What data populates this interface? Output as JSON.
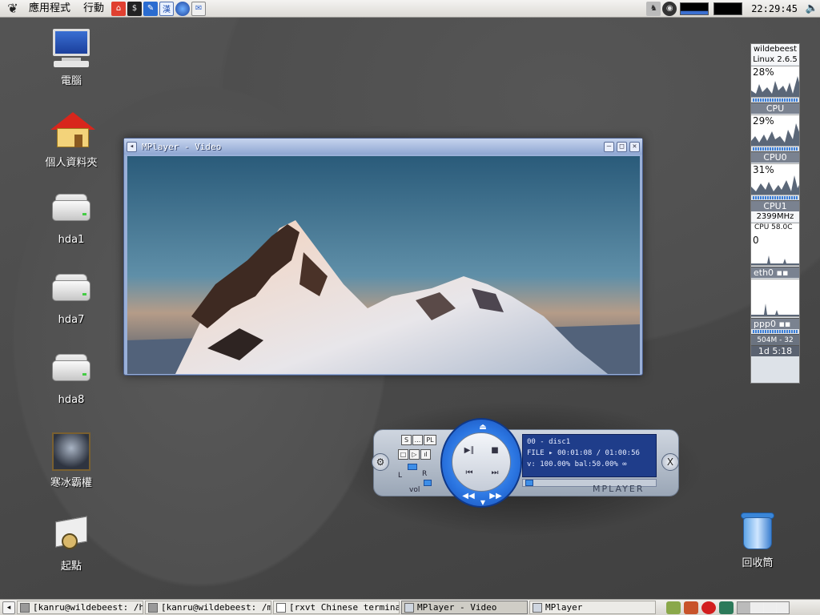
{
  "top_panel": {
    "menus": [
      "應用程式",
      "行動"
    ],
    "clock": "22:29:45"
  },
  "desktop_icons": {
    "computer": "電腦",
    "home": "個人資料夾",
    "hda1": "hda1",
    "hda7": "hda7",
    "hda8": "hda8",
    "game": "寒冰霸權",
    "start_here": "起點",
    "trash": "回收筒"
  },
  "video_window": {
    "title": "MPlayer - Video"
  },
  "mplayer": {
    "btn_s": "S",
    "btn_dots": "...",
    "btn_pl": "PL",
    "track": "00 - disc1",
    "source": "FILE",
    "time": "00:01:08 / 01:00:56",
    "volume_line": "v: 100.00%  bal:50.00%",
    "vol_label": "vol",
    "left_label": "L",
    "right_label": "R",
    "brand": "MPLAYER",
    "seek_fraction": 0.02,
    "close_symbol": "X"
  },
  "sys_monitor": {
    "hostname": "wildebeest",
    "kernel": "Linux 2.6.5",
    "cpu": {
      "percent": "28%",
      "label": "CPU"
    },
    "cpu0": {
      "percent": "29%",
      "label": "CPU0"
    },
    "cpu1": {
      "percent": "31%",
      "label": "CPU1"
    },
    "freq": "2399MHz",
    "temp": "CPU  58.0C",
    "net_value": "0",
    "eth0": "eth0",
    "ppp0": "ppp0",
    "mem": "504M - 32",
    "uptime": "1d  5:18"
  },
  "taskbar": {
    "tasks": [
      "[kanru@wildebeest: /hom",
      "[kanru@wildebeest: /mnt",
      "[rxvt Chinese terminal (",
      "MPlayer - Video",
      "MPlayer"
    ]
  },
  "colors": {
    "panel_bg": "#dcdad5",
    "lcd_bg": "#1f3d8a",
    "dial_blue": "#2a74e0"
  }
}
